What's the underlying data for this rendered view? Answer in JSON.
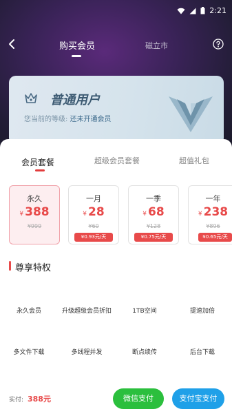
{
  "status_bar": {
    "time": "2:21"
  },
  "nav": {
    "title": "购买会员",
    "tab2": "磁立市"
  },
  "card": {
    "title": "普通用户",
    "level_label": "您当前的等级:",
    "level_value": "还未开通会员"
  },
  "tabs": [
    "会员套餐",
    "超级会员套餐",
    "超值礼包"
  ],
  "plans": [
    {
      "name": "永久",
      "price": "388",
      "currency": "¥",
      "original": "¥999",
      "daily": ""
    },
    {
      "name": "一月",
      "price": "28",
      "currency": "¥",
      "original": "¥60",
      "daily": "¥0.93元/天"
    },
    {
      "name": "一季",
      "price": "68",
      "currency": "¥",
      "original": "¥128",
      "daily": "¥0.75元/天"
    },
    {
      "name": "一年",
      "price": "238",
      "currency": "¥",
      "original": "¥896",
      "daily": "¥0.65元/天"
    }
  ],
  "privileges_title": "尊享特权",
  "privileges": [
    "永久会员",
    "升级超级会员折扣",
    "1TB空间",
    "提速加倍",
    "多文件下载",
    "多线程并发",
    "断点续传",
    "后台下载"
  ],
  "pay": {
    "label": "实付:",
    "amount": "388元",
    "wechat": "微信支付",
    "alipay": "支付宝支付"
  },
  "colors": {
    "accent": "#e84a4a",
    "wechat": "#2bbf3d",
    "alipay": "#1fa0e8"
  }
}
